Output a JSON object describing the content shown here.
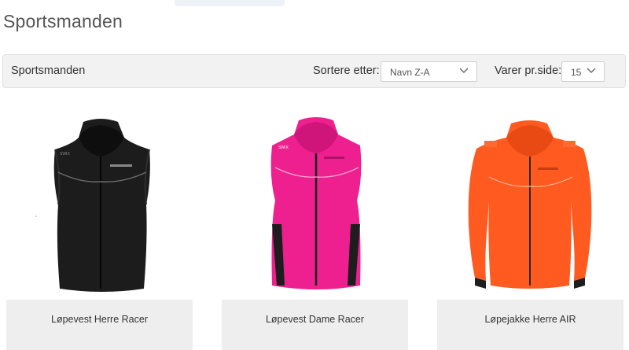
{
  "page": {
    "title": "Sportsmanden"
  },
  "toolbar": {
    "category_title": "Sportsmanden",
    "sort_label": "Sortere etter:",
    "sort_value": "Navn Z-A",
    "per_page_label": "Varer pr.side:",
    "per_page_value": "15"
  },
  "products": [
    {
      "name": "Løpevest Herre Racer",
      "color": "#1b1b1b"
    },
    {
      "name": "Løpevest Dame Racer",
      "color": "#ee1f8e"
    },
    {
      "name": "Løpejakke Herre AIR",
      "color": "#ff5a1f"
    }
  ]
}
